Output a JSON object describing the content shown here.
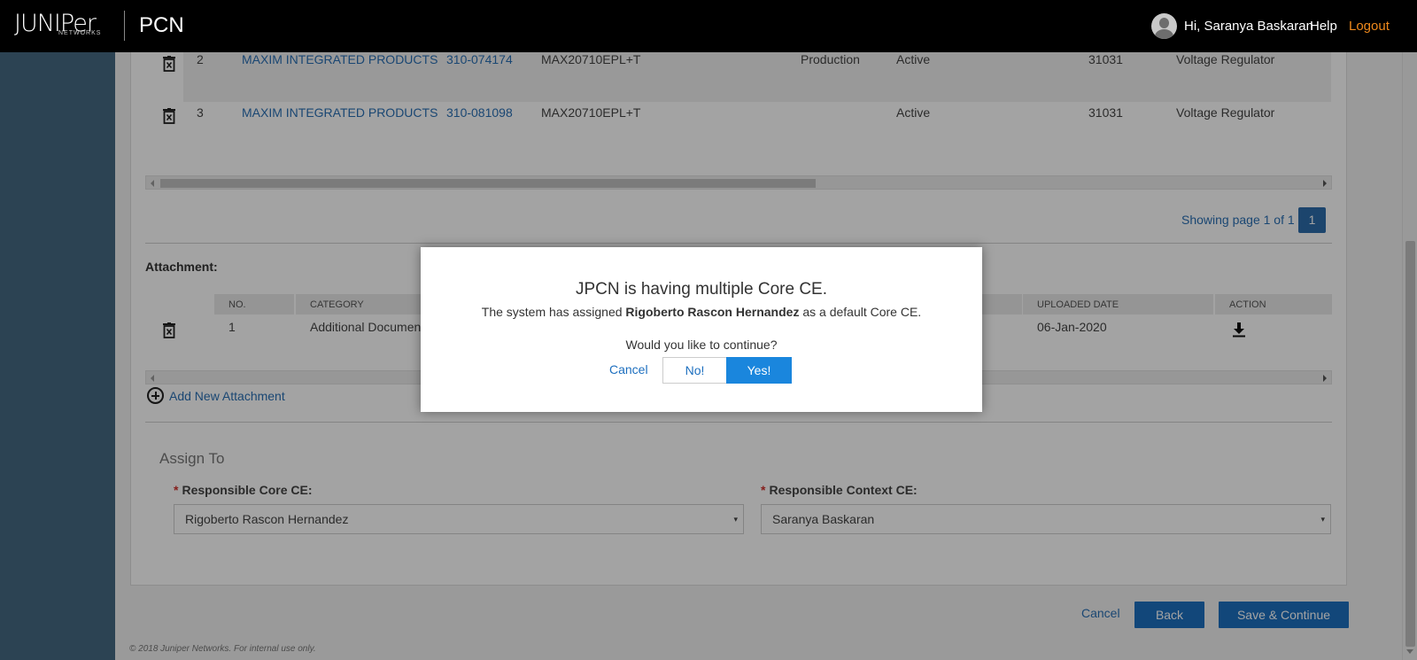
{
  "header": {
    "logo": "JUNIPer",
    "logo_sub": "NETWORKS",
    "app_name": "PCN",
    "greeting": "Hi, Saranya Baskaran",
    "help": "Help",
    "logout": "Logout"
  },
  "parts_table": {
    "rows": [
      {
        "no": "2",
        "manufacturer": "MAXIM INTEGRATED PRODUCTS",
        "part_number": "310-074174",
        "mfr_part": "MAX20710EPL+T",
        "stage": "Production",
        "status": "Active",
        "code": "31031",
        "description": "Voltage Regulator"
      },
      {
        "no": "3",
        "manufacturer": "MAXIM INTEGRATED PRODUCTS",
        "part_number": "310-081098",
        "mfr_part": "MAX20710EPL+T",
        "stage": "",
        "status": "Active",
        "code": "31031",
        "description": "Voltage Regulator"
      }
    ],
    "pagination_text": "Showing page 1 of 1",
    "current_page": "1"
  },
  "attachments": {
    "title": "Attachment:",
    "columns": [
      "NO.",
      "CATEGORY",
      "UPLOADED DATE",
      "ACTION"
    ],
    "rows": [
      {
        "no": "1",
        "category": "Additional Documen",
        "uploaded_date": "06-Jan-2020"
      }
    ],
    "add_label": "Add New Attachment"
  },
  "assign": {
    "title": "Assign To",
    "core_label": "Responsible Core CE:",
    "core_value": "Rigoberto Rascon Hernandez",
    "context_label": "Responsible Context CE:",
    "context_value": "Saranya Baskaran",
    "required_mark": "*"
  },
  "footer": {
    "cancel": "Cancel",
    "back": "Back",
    "save": "Save & Continue",
    "copyright": "© 2018 Juniper Networks. For internal use only."
  },
  "modal": {
    "title": "JPCN is having multiple Core CE.",
    "msg_prefix": "The system has assigned ",
    "msg_name": "Rigoberto Rascon Hernandez",
    "msg_suffix": " as a default Core CE.",
    "question": "Would you like to continue?",
    "cancel": "Cancel",
    "no": "No!",
    "yes": "Yes!"
  },
  "icons": {
    "trash": "trash-icon",
    "download": "download-icon",
    "add": "plus-circle-icon",
    "caret": "▾"
  },
  "colors": {
    "header_bg": "#000000",
    "sidebar_bg": "#456982",
    "link": "#2a6fb4",
    "primary_button": "#1d6fbf",
    "yes_button": "#1a86dd",
    "logout": "#f08a1c"
  }
}
